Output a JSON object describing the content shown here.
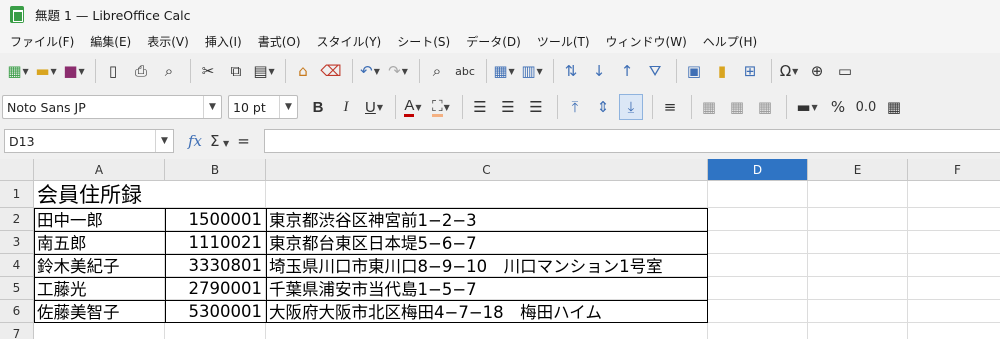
{
  "window": {
    "title": "無題 1 — LibreOffice Calc"
  },
  "menu": [
    "ファイル(F)",
    "編集(E)",
    "表示(V)",
    "挿入(I)",
    "書式(O)",
    "スタイル(Y)",
    "シート(S)",
    "データ(D)",
    "ツール(T)",
    "ウィンドウ(W)",
    "ヘルプ(H)"
  ],
  "format": {
    "font_name": "Noto Sans JP",
    "font_size": "10 pt",
    "percent_symbol": "%",
    "decimal_symbol": "0.0"
  },
  "formula_bar": {
    "cell_ref": "D13",
    "fx_label": "fx",
    "sum_label": "Σ",
    "equals_label": "=",
    "value": ""
  },
  "sheet": {
    "columns": [
      "A",
      "B",
      "C",
      "D",
      "E",
      "F"
    ],
    "active_column": "D",
    "rows": [
      "1",
      "2",
      "3",
      "4",
      "5",
      "6",
      "7"
    ],
    "title": "会員住所録",
    "records": [
      {
        "name": "田中一郎",
        "zip": "1500001",
        "address": "東京都渋谷区神宮前1−2−3"
      },
      {
        "name": "南五郎",
        "zip": "1110021",
        "address": "東京都台東区日本堤5−6−7"
      },
      {
        "name": "鈴木美紀子",
        "zip": "3330801",
        "address": "埼玉県川口市東川口8−9−10　川口マンション1号室"
      },
      {
        "name": "工藤光",
        "zip": "2790001",
        "address": "千葉県浦安市当代島1−5−7"
      },
      {
        "name": "佐藤美智子",
        "zip": "5300001",
        "address": "大阪府大阪市北区梅田4−7−18　梅田ハイム"
      }
    ]
  },
  "colors": {
    "accent": "#2f74c4",
    "app_green": "#3a9e47",
    "fx_blue": "#3f6fb5",
    "font_color_red": "#c00000"
  }
}
